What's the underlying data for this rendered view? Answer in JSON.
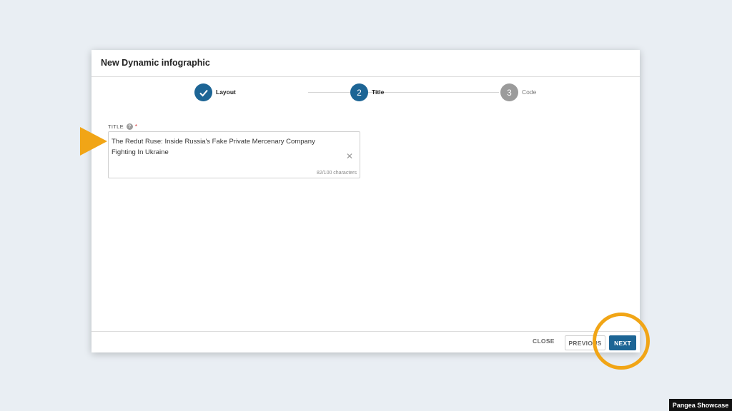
{
  "dialog": {
    "title": "New Dynamic infographic"
  },
  "stepper": {
    "steps": [
      {
        "number": "",
        "label": "Layout",
        "state": "done",
        "icon": "checkmark-icon"
      },
      {
        "number": "2",
        "label": "Title",
        "state": "active"
      },
      {
        "number": "3",
        "label": "Code",
        "state": "pending"
      }
    ]
  },
  "form": {
    "title_field": {
      "label": "TITLE",
      "help_icon": "question-mark-icon",
      "required_marker": "*",
      "value": "The Redut Ruse: Inside Russia's Fake Private Mercenary Company\nFighting In Ukraine",
      "clear_icon": "close-icon",
      "char_count": "82/100 characters"
    }
  },
  "footer": {
    "close_label": "CLOSE",
    "previous_label": "PREVIOUS",
    "next_label": "NEXT"
  },
  "overlay": {
    "watermark": "Pangea Showcase",
    "callout_color": "#f1a516"
  },
  "colors": {
    "primary": "#1d6595",
    "pending": "#9b9b9b",
    "background": "#e9eef3"
  }
}
